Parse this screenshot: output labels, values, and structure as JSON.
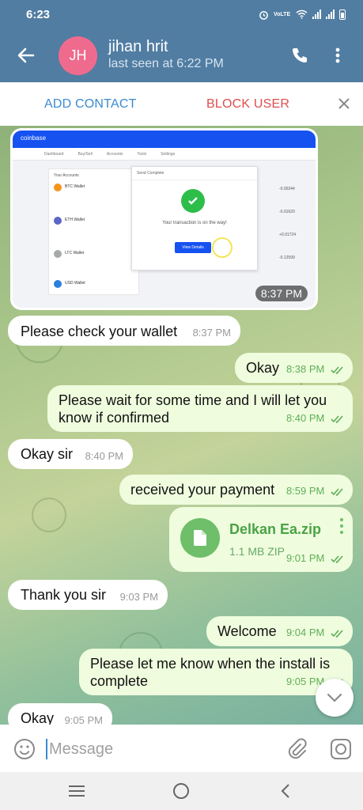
{
  "status_bar": {
    "time": "6:23",
    "net_label": "VoLTE",
    "battery_icon": "battery-icon"
  },
  "header": {
    "avatar_initials": "JH",
    "avatar_color": "#ef6b8d",
    "contact_name": "jihan hrit",
    "last_seen": "last seen at 6:22 PM",
    "accent": "#517da2"
  },
  "action_bar": {
    "add_contact": "ADD CONTACT",
    "block_user": "BLOCK USER"
  },
  "messages": [
    {
      "type": "image",
      "direction": "in",
      "time": "8:37 PM",
      "screenshot": {
        "brand": "coinbase",
        "tabs": [
          "Dashboard",
          "Buy/Sell",
          "Accounts",
          "Tools",
          "Settings"
        ],
        "section": "Your Accounts",
        "wallets": [
          {
            "name": "BTC Wallet",
            "color": "#f7931a"
          },
          {
            "name": "ETH Wallet",
            "color": "#5b66c6"
          },
          {
            "name": "LTC Wallet",
            "color": "#a6a9aa"
          },
          {
            "name": "USD Wallet",
            "color": "#2a7fdb"
          }
        ],
        "modal_title": "Send Complete",
        "modal_message": "Your transaction is on the way!",
        "modal_button": "View Details",
        "side_values": [
          "-0.00244",
          "-0.01620",
          "+0.01724",
          "-0.12599"
        ]
      }
    },
    {
      "type": "text",
      "direction": "in",
      "text": "Please check your wallet",
      "time": "8:37 PM"
    },
    {
      "type": "text",
      "direction": "out",
      "text": "Okay",
      "time": "8:38 PM",
      "read": true
    },
    {
      "type": "text",
      "direction": "out",
      "text": "Please wait for some time and I will let you know if confirmed",
      "time": "8:40 PM",
      "read": true
    },
    {
      "type": "text",
      "direction": "in",
      "text": "Okay sir",
      "time": "8:40 PM"
    },
    {
      "type": "text",
      "direction": "out",
      "text": "received your payment",
      "time": "8:59 PM",
      "read": true
    },
    {
      "type": "file",
      "direction": "out",
      "file_name": "Delkan Ea.zip",
      "file_size": "1.1 MB ZIP",
      "time": "9:01 PM",
      "read": true
    },
    {
      "type": "text",
      "direction": "in",
      "text": "Thank you sir",
      "time": "9:03 PM"
    },
    {
      "type": "text",
      "direction": "out",
      "text": "Welcome",
      "time": "9:04 PM",
      "read": true
    },
    {
      "type": "text",
      "direction": "out",
      "text": "Please let me know when the install is complete",
      "time": "9:05 PM",
      "read": true
    },
    {
      "type": "text",
      "direction": "in",
      "text": "Okay",
      "time": "9:05 PM"
    }
  ],
  "input": {
    "placeholder": "Message"
  }
}
